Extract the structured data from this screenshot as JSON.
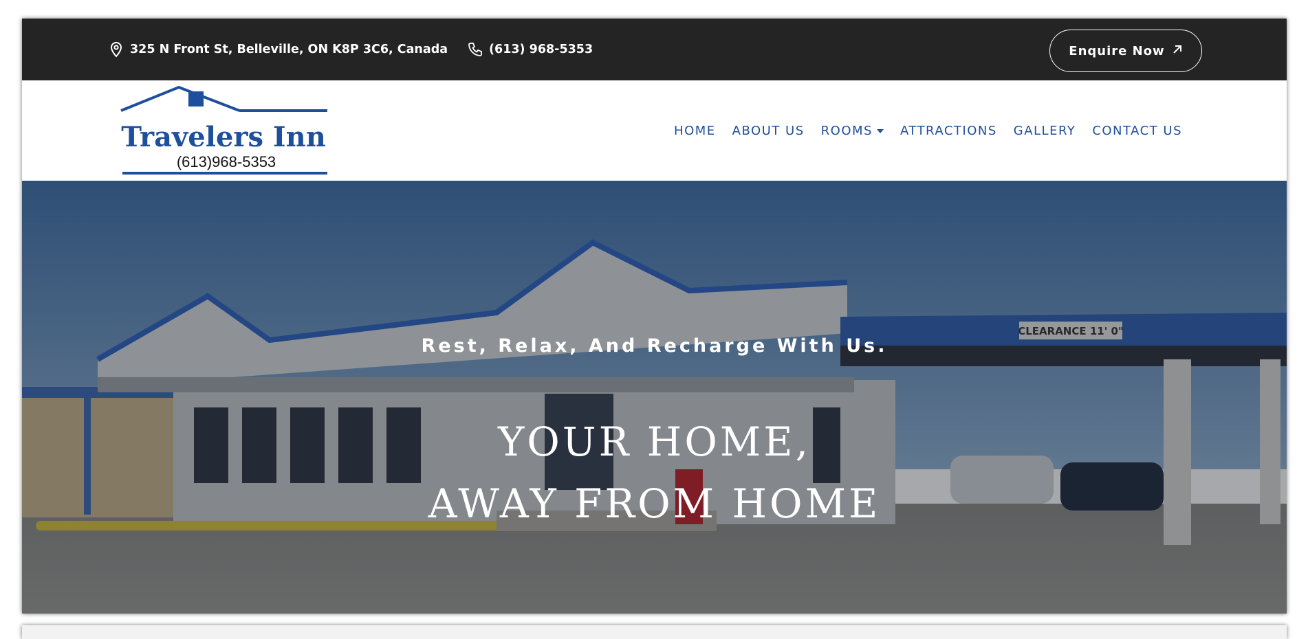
{
  "topbar": {
    "address": "325 N Front St, Belleville, ON K8P 3C6, Canada",
    "phone": "(613) 968-5353",
    "enquire_label": "Enquire Now"
  },
  "logo": {
    "name": "Travelers Inn",
    "phone": "(613)968-5353"
  },
  "nav": {
    "items": [
      {
        "label": "HOME"
      },
      {
        "label": "ABOUT US"
      },
      {
        "label": "ROOMS"
      },
      {
        "label": "ATTRACTIONS"
      },
      {
        "label": "GALLERY"
      },
      {
        "label": "CONTACT US"
      }
    ]
  },
  "hero": {
    "tagline": "Rest, Relax, And Recharge With Us.",
    "headline_line1": "YOUR HOME,",
    "headline_line2": "AWAY FROM HOME",
    "sign_text": "CLEARANCE 11' 0\""
  },
  "colors": {
    "topbar_bg": "#242424",
    "brand_blue": "#1e4f9c",
    "white": "#ffffff"
  },
  "icons": {
    "address": "map-pin-icon",
    "phone": "phone-icon",
    "enquire": "arrow-up-right-icon",
    "dropdown": "chevron-down-icon"
  }
}
